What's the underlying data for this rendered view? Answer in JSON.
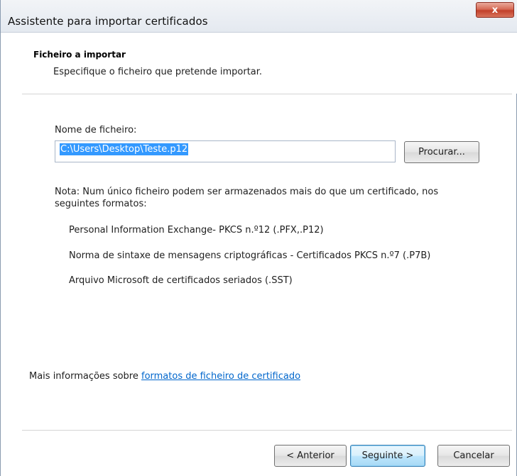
{
  "window": {
    "title": "Assistente para importar certificados",
    "close_label": "x"
  },
  "header": {
    "title": "Ficheiro a importar",
    "subtitle": "Especifique o ficheiro que pretende importar."
  },
  "file": {
    "label": "Nome de ficheiro:",
    "value": "C:\\Users\\Desktop\\Teste.p12",
    "browse_label": "Procurar..."
  },
  "note": {
    "text": "Nota: Num único ficheiro podem ser armazenados mais do que um certificado, nos seguintes formatos:",
    "formats": [
      "Personal Information Exchange- PKCS n.º12 (.PFX,.P12)",
      "Norma de sintaxe de mensagens criptográficas - Certificados PKCS n.º7 (.P7B)",
      "Arquivo Microsoft de certificados seriados (.SST)"
    ]
  },
  "more_info": {
    "prefix": "Mais informações sobre ",
    "link": "formatos de ficheiro de certificado"
  },
  "buttons": {
    "back": "< Anterior",
    "next": "Seguinte >",
    "cancel": "Cancelar"
  },
  "colors": {
    "selection": "#3399ff",
    "link": "#0066cc",
    "close": "#c2402a"
  }
}
